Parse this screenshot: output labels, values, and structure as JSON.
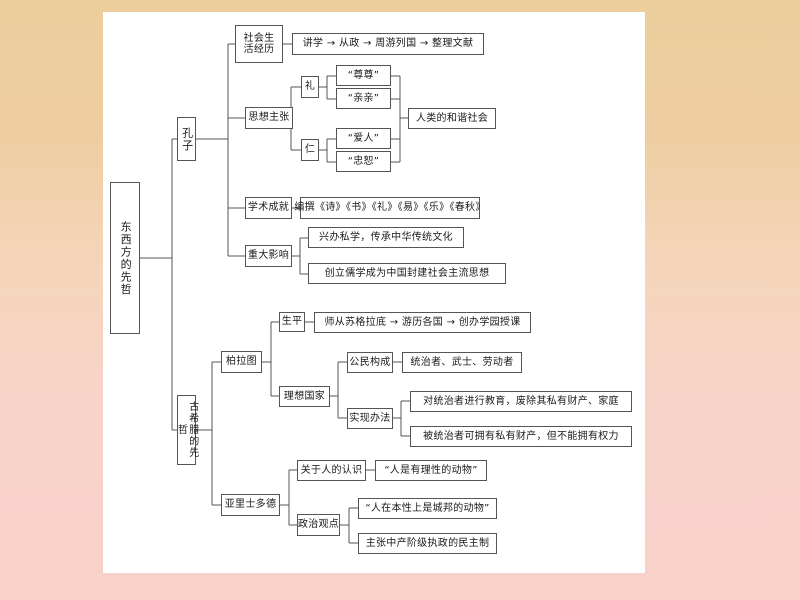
{
  "diagram": {
    "title": "东西方的先哲",
    "root": {
      "label": "东西方的先哲"
    },
    "branch_confucius": {
      "label": "孔子",
      "life": {
        "label": "社会生\n活经历",
        "detail": "讲学 → 从政 → 周游列国 → 整理文献"
      },
      "thought": {
        "label": "思想主张",
        "li": {
          "label": "礼",
          "items": [
            "“尊尊”",
            "“亲亲”"
          ]
        },
        "ren": {
          "label": "仁",
          "items": [
            "“爱人”",
            "“忠恕”"
          ]
        },
        "result": "人类的和谐社会"
      },
      "academic": {
        "label": "学术成就",
        "detail": "编撰《诗》《书》《礼》《易》《乐》《春秋》"
      },
      "impact": {
        "label": "重大影响",
        "items": [
          "兴办私学，传承中华传统文化",
          "创立儒学成为中国封建社会主流思想"
        ]
      }
    },
    "branch_greek": {
      "label": "古希腊的先哲",
      "plato": {
        "label": "柏拉图",
        "life": {
          "label": "生平",
          "detail": "师从苏格拉底 → 游历各国 → 创办学园授课"
        },
        "ideal_state": {
          "label": "理想国家",
          "citizens": {
            "label": "公民构成",
            "detail": "统治者、武士、劳动者"
          },
          "methods": {
            "label": "实现办法",
            "items": [
              "对统治者进行教育，废除其私有财产、家庭",
              "被统治者可拥有私有财产，但不能拥有权力"
            ]
          }
        }
      },
      "aristotle": {
        "label": "亚里士多德",
        "human": {
          "label": "关于人的认识",
          "detail": "“人是有理性的动物”"
        },
        "politics": {
          "label": "政治观点",
          "items": [
            "“人在本性上是城邦的动物”",
            "主张中产阶级执政的民主制"
          ]
        }
      }
    },
    "colors": {
      "background_top": "#eccd9c",
      "background_bottom": "#f8d3ca",
      "paper": "#ffffff",
      "line": "#555555",
      "text": "#1a1a1a"
    }
  }
}
